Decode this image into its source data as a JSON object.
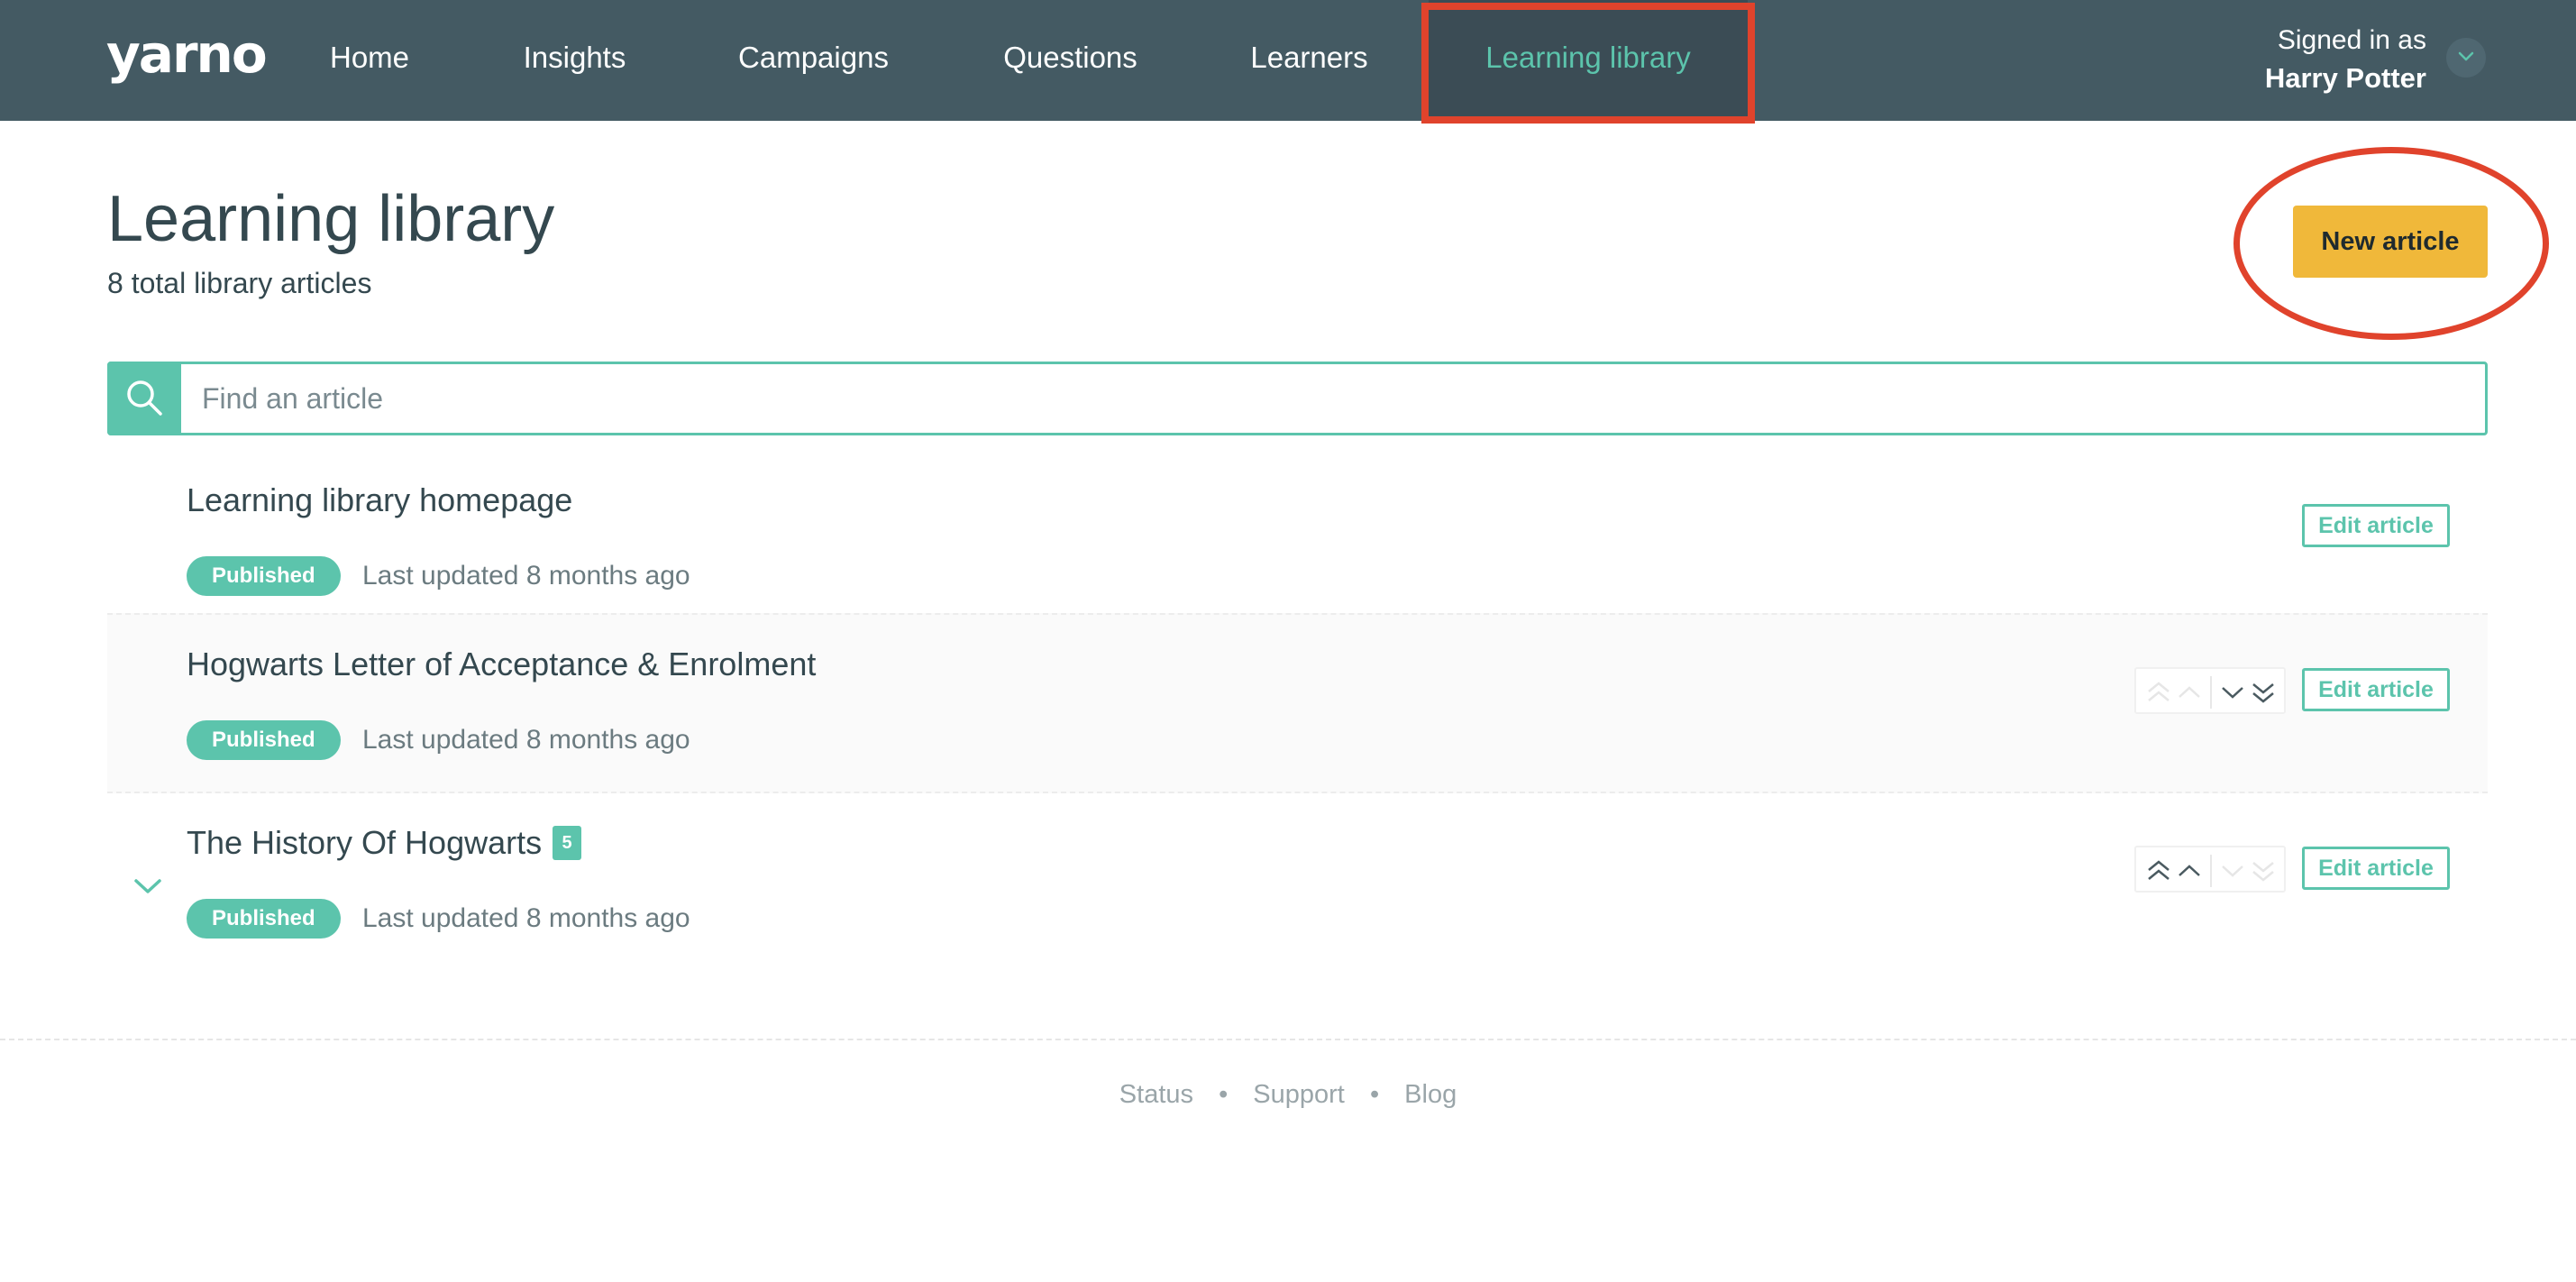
{
  "nav": {
    "logo": "yarno",
    "items": [
      {
        "label": "Home"
      },
      {
        "label": "Insights"
      },
      {
        "label": "Campaigns"
      },
      {
        "label": "Questions"
      },
      {
        "label": "Learners"
      },
      {
        "label": "Learning library",
        "active": true
      }
    ],
    "signed_in_label": "Signed in as",
    "user_name": "Harry Potter"
  },
  "header": {
    "title": "Learning library",
    "subtitle": "8 total library articles",
    "new_article_label": "New article"
  },
  "search": {
    "placeholder": "Find an article"
  },
  "articles": [
    {
      "title": "Learning library homepage",
      "status": "Published",
      "updated": "Last updated 8 months ago",
      "edit_label": "Edit article"
    },
    {
      "title": "Hogwarts Letter of Acceptance & Enrolment",
      "status": "Published",
      "updated": "Last updated 8 months ago",
      "edit_label": "Edit article"
    },
    {
      "title": "The History Of Hogwarts",
      "count": "5",
      "status": "Published",
      "updated": "Last updated 8 months ago",
      "edit_label": "Edit article"
    }
  ],
  "footer": {
    "links": [
      "Status",
      "Support",
      "Blog"
    ],
    "separator": "•"
  },
  "colors": {
    "nav_bg": "#445a63",
    "accent": "#5cc4ac",
    "cta": "#f0b83a",
    "annotation": "#e0432c"
  },
  "icons": {
    "search": "search-icon",
    "user_menu": "chevron-down-icon",
    "expand": "chevron-down-icon",
    "move_top": "double-chevron-up-icon",
    "move_up": "chevron-up-icon",
    "move_down": "chevron-down-icon",
    "move_bottom": "double-chevron-down-icon"
  }
}
